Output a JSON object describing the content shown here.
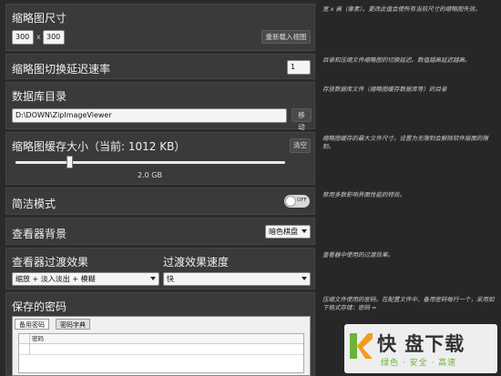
{
  "thumbnail_size": {
    "title": "缩略图尺寸",
    "width": "300",
    "sep": "x",
    "height": "300",
    "reload_btn": "重新载入视图"
  },
  "thumb_delay": {
    "title": "缩略图切换延迟速率",
    "value": "1"
  },
  "db_dir": {
    "title": "数据库目录",
    "path": "D:\\DOWN\\ZipImageViewer",
    "move_btn": "移动"
  },
  "cache": {
    "title": "缩略图缓存大小（当前: 1012 KB）",
    "clear_btn": "清空",
    "slider_value_label": "2.0 GB",
    "slider_fraction": 0.2
  },
  "simple_mode": {
    "title": "简洁模式",
    "toggle_label": "OFF"
  },
  "viewer_bg": {
    "title": "查看器背景",
    "selected": "暗色棋盘"
  },
  "transition": {
    "title": "查看器过渡效果",
    "selected": "缩放 + 淡入淡出 + 模糊",
    "speed_title": "过渡效果速度",
    "speed_selected": "快"
  },
  "passwords": {
    "title": "保存的密码",
    "tabs": [
      "备用密码",
      "密码字典"
    ],
    "col_header": "密码"
  },
  "descriptions": {
    "d1": "宽 x 高（像素）。更改此值会使所有当前尺寸的缩略图失效。",
    "d2": "目录和压缩文件缩略图的切换延迟。数值越高延迟越高。",
    "d3": "存放数据库文件（缩略图缓存数据库等）的目录",
    "d4": "缩略图缓存的最大文件尺寸。设置为无限制会解除软件层面的限制。",
    "d5": "禁用多数影响界面性能的特效。",
    "d6": "查看器中使用的过渡效果。",
    "d7": "压缩文件使用的密码。在配置文件中，备用密码每行一个，采用如下格式存储：密码 ="
  },
  "watermark": {
    "brand": "快 盘下载",
    "slogan": "绿色 · 安全 · 高速"
  },
  "colors": {
    "bg": "#2a2a2a",
    "panel": "#3a3a3a",
    "accent_orange": "#f29b1d",
    "watermark_green": "#6bb33a"
  }
}
